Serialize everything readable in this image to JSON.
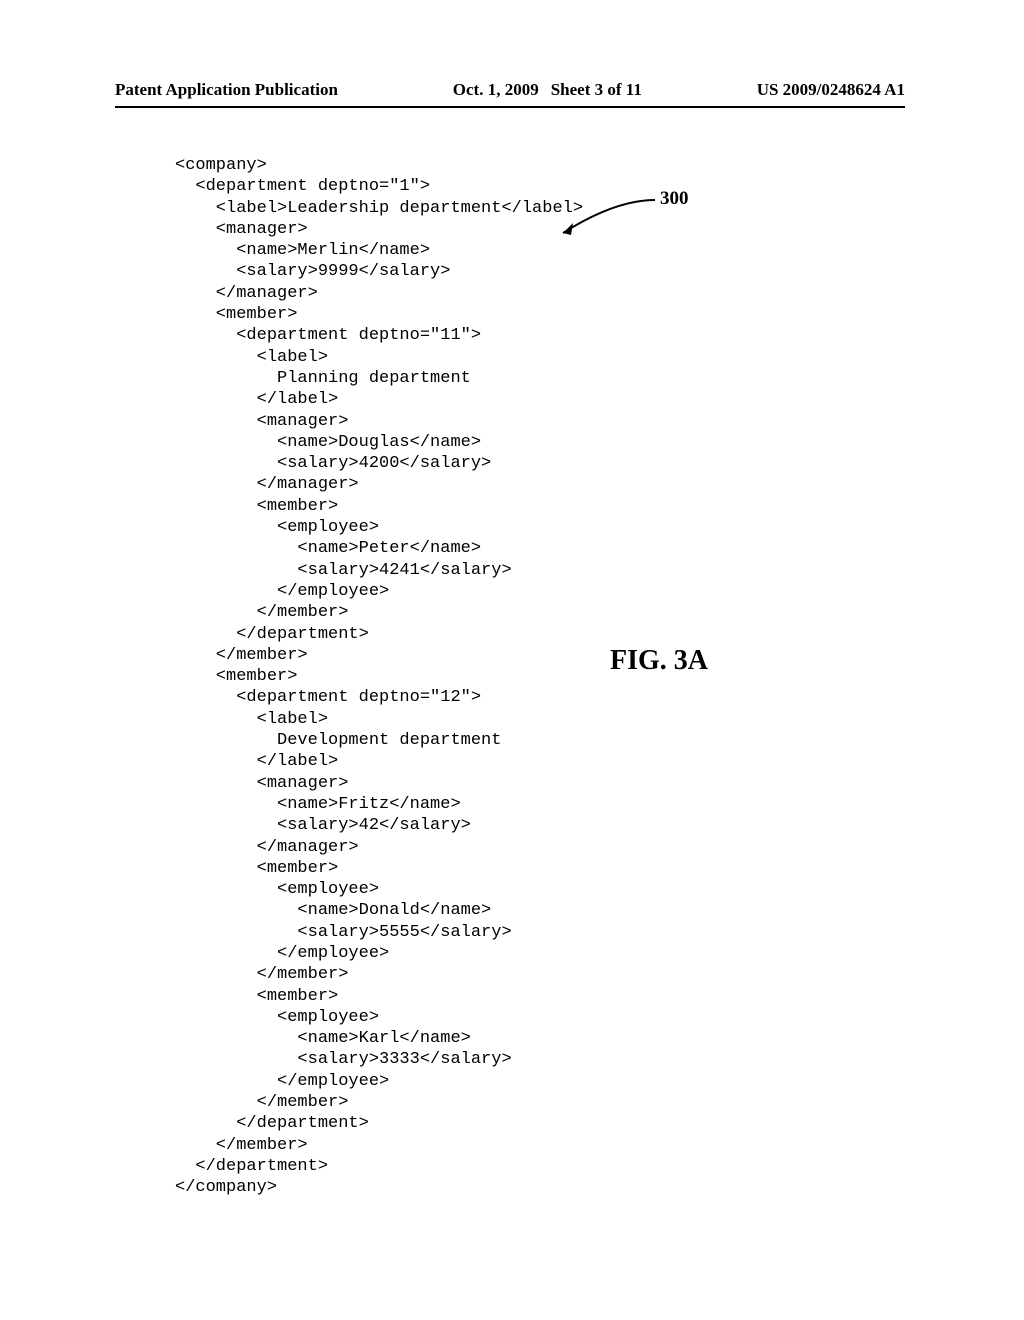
{
  "header": {
    "left": "Patent Application Publication",
    "mid_date": "Oct. 1, 2009",
    "mid_sheet": "Sheet 3 of 11",
    "right": "US 2009/0248624 A1"
  },
  "figure_label": "FIG. 3A",
  "ref_num": "300",
  "code": "<company>\n  <department deptno=\"1\">\n    <label>Leadership department</label>\n    <manager>\n      <name>Merlin</name>\n      <salary>9999</salary>\n    </manager>\n    <member>\n      <department deptno=\"11\">\n        <label>\n          Planning department\n        </label>\n        <manager>\n          <name>Douglas</name>\n          <salary>4200</salary>\n        </manager>\n        <member>\n          <employee>\n            <name>Peter</name>\n            <salary>4241</salary>\n          </employee>\n        </member>\n      </department>\n    </member>\n    <member>\n      <department deptno=\"12\">\n        <label>\n          Development department\n        </label>\n        <manager>\n          <name>Fritz</name>\n          <salary>42</salary>\n        </manager>\n        <member>\n          <employee>\n            <name>Donald</name>\n            <salary>5555</salary>\n          </employee>\n        </member>\n        <member>\n          <employee>\n            <name>Karl</name>\n            <salary>3333</salary>\n          </employee>\n        </member>\n      </department>\n    </member>\n  </department>\n</company>"
}
